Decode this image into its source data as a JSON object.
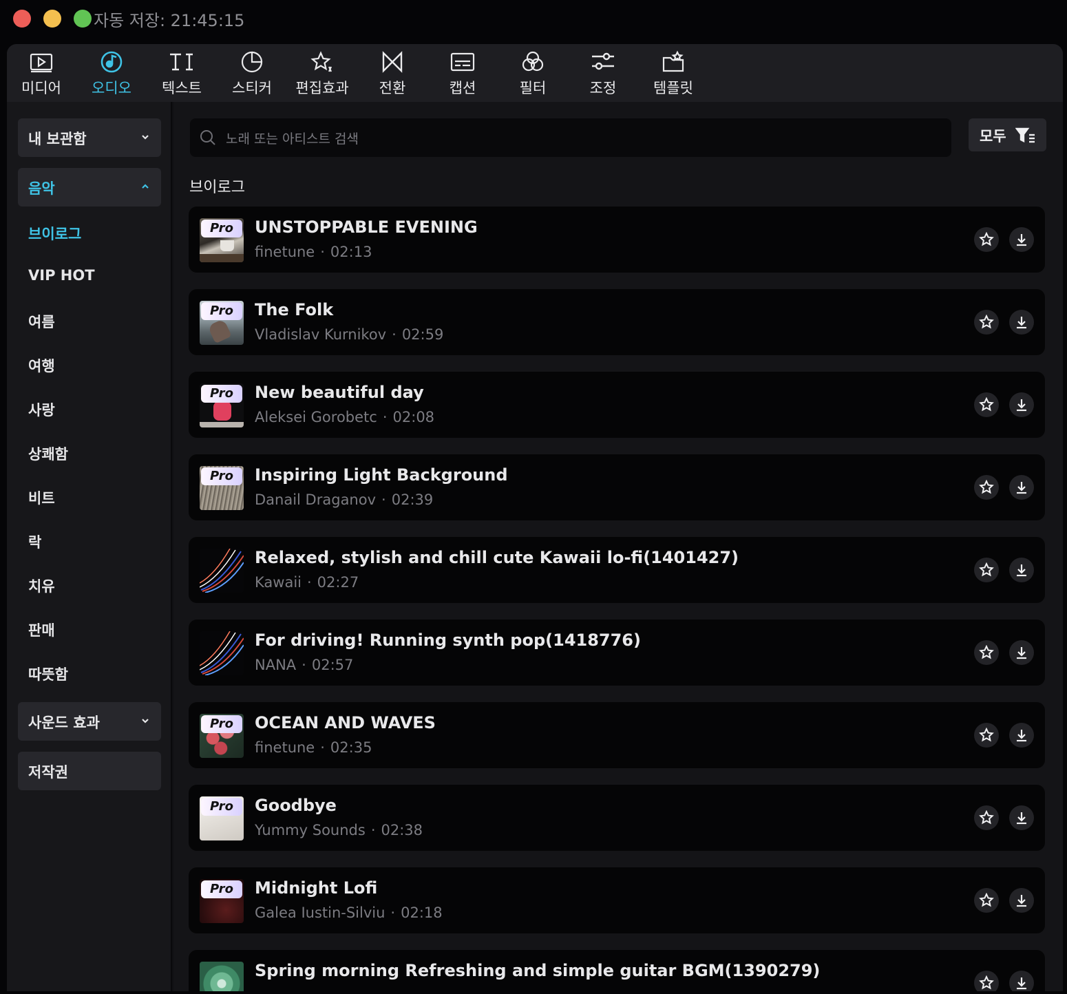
{
  "titlebar": {
    "autosave": "자동 저장: 21:45:15"
  },
  "toolbar": {
    "tools": [
      {
        "label": "미디어",
        "icon": "media-play-icon"
      },
      {
        "label": "오디오",
        "icon": "music-note-icon",
        "active": true
      },
      {
        "label": "텍스트",
        "icon": "text-ti-icon"
      },
      {
        "label": "스티커",
        "icon": "sticker-icon"
      },
      {
        "label": "편집효과",
        "icon": "sparkle-star-icon"
      },
      {
        "label": "전환",
        "icon": "transition-icon"
      },
      {
        "label": "캡션",
        "icon": "caption-icon"
      },
      {
        "label": "필터",
        "icon": "filter-circles-icon"
      },
      {
        "label": "조정",
        "icon": "adjust-sliders-icon"
      },
      {
        "label": "템플릿",
        "icon": "template-icon"
      }
    ]
  },
  "sidebar": {
    "my_library": "내 보관함",
    "music": "음악",
    "music_items": [
      "브이로그",
      "VIP HOT",
      "여름",
      "여행",
      "사랑",
      "상쾌함",
      "비트",
      "락",
      "치유",
      "판매",
      "따뜻함"
    ],
    "sound_effects": "사운드 효과",
    "copyright": "저작권"
  },
  "search": {
    "placeholder": "노래 또는 아티스트 검색"
  },
  "filter": {
    "label": "모두"
  },
  "section": {
    "title": "브이로그"
  },
  "colors": {
    "accent": "#3fc3e6"
  },
  "tracks": [
    {
      "title": "UNSTOPPABLE EVENING",
      "artist": "finetune",
      "duration": "02:13",
      "pro": true,
      "thumb": "cozy-mug"
    },
    {
      "title": "The Folk",
      "artist": "Vladislav Kurnikov",
      "duration": "02:59",
      "pro": true,
      "thumb": "hand-water"
    },
    {
      "title": "New beautiful day",
      "artist": "Aleksei Gorobetc",
      "duration": "02:08",
      "pro": true,
      "thumb": "red-skates"
    },
    {
      "title": "Inspiring Light Background",
      "artist": "Danail Draganov",
      "duration": "02:39",
      "pro": true,
      "thumb": "dry-grass"
    },
    {
      "title": "Relaxed, stylish and chill cute Kawaii lo-fi(1401427)",
      "artist": "Kawaii",
      "duration": "02:27",
      "pro": false,
      "thumb": "light-trails"
    },
    {
      "title": "For driving! Running synth pop(1418776)",
      "artist": "NANA",
      "duration": "02:57",
      "pro": false,
      "thumb": "light-trails"
    },
    {
      "title": "OCEAN AND WAVES",
      "artist": "finetune",
      "duration": "02:35",
      "pro": true,
      "thumb": "red-flowers"
    },
    {
      "title": "Goodbye",
      "artist": "Yummy Sounds",
      "duration": "02:38",
      "pro": true,
      "thumb": "white-fabric"
    },
    {
      "title": "Midnight Lofi",
      "artist": "Galea Iustin-Silviu",
      "duration": "02:18",
      "pro": true,
      "thumb": "dark-red"
    },
    {
      "title": "Spring morning Refreshing and simple guitar BGM(1390279)",
      "artist": "",
      "duration": "",
      "pro": false,
      "thumb": "green-leaves"
    }
  ]
}
